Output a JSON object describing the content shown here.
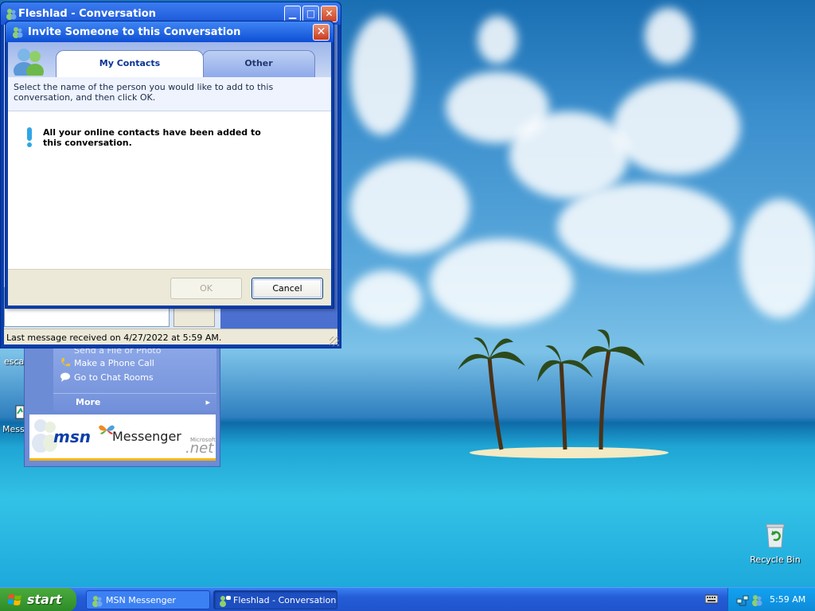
{
  "desktop": {
    "icons": [
      {
        "label": "Recycle Bin"
      },
      {
        "label": "escar"
      },
      {
        "label": "Messe"
      }
    ]
  },
  "conversation_window": {
    "title": "Fleshlad - Conversation",
    "status": "Last message received on 4/27/2022 at 5:59 AM."
  },
  "msn_panel": {
    "tasks": [
      {
        "label": "Send a File or Photo",
        "icon": "file-icon"
      },
      {
        "label": "Make a Phone Call",
        "icon": "phone-icon"
      },
      {
        "label": "Go to Chat Rooms",
        "icon": "chat-icon"
      }
    ],
    "more_label": "More",
    "logo": {
      "brand": "msn",
      "product": "Messenger",
      "company": "Microsoft",
      "suffix": ".net"
    }
  },
  "invite_dialog": {
    "title": "Invite Someone to this Conversation",
    "tabs": [
      {
        "label": "My Contacts",
        "active": true
      },
      {
        "label": "Other",
        "active": false
      }
    ],
    "instructions": "Select the name of the person you would like to add to this conversation, and then click OK.",
    "message": "All your online contacts have been added to this conversation.",
    "ok_label": "OK",
    "cancel_label": "Cancel"
  },
  "taskbar": {
    "start_label": "start",
    "tasks": [
      {
        "label": "MSN Messenger",
        "active": false
      },
      {
        "label": "Fleshlad - Conversation",
        "active": true
      }
    ],
    "clock": "5:59 AM"
  },
  "colors": {
    "xp_blue": "#0a3ea8",
    "start_green": "#2d8b27",
    "tray_blue": "#0d8ad8"
  }
}
